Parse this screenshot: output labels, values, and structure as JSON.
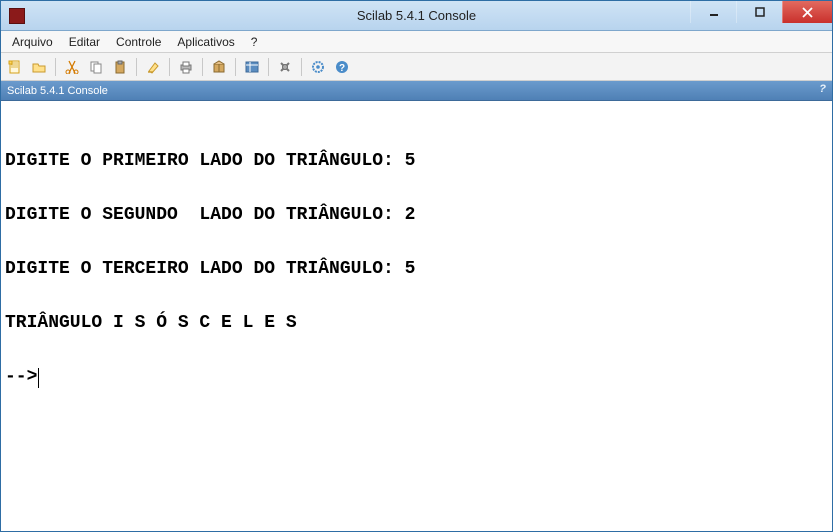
{
  "window": {
    "title": "Scilab 5.4.1 Console"
  },
  "menu": {
    "items": [
      "Arquivo",
      "Editar",
      "Controle",
      "Aplicativos",
      "?"
    ]
  },
  "subheader": {
    "title": "Scilab 5.4.1 Console",
    "help": "?"
  },
  "toolbar": {
    "icons": [
      "new-file-icon",
      "open-file-icon",
      "sep",
      "cut-icon",
      "copy-icon",
      "paste-icon",
      "sep",
      "clear-icon",
      "sep",
      "print-icon",
      "sep",
      "package-icon",
      "sep",
      "variable-browser-icon",
      "sep",
      "preferences-icon",
      "sep",
      "settings-gear-icon",
      "help-icon"
    ]
  },
  "console": {
    "lines": [
      "DIGITE O PRIMEIRO LADO DO TRIÂNGULO: 5",
      "DIGITE O SEGUNDO  LADO DO TRIÂNGULO: 2",
      "DIGITE O TERCEIRO LADO DO TRIÂNGULO: 5",
      "TRIÂNGULO I S Ó S C E L E S"
    ],
    "prompt": "-->"
  }
}
